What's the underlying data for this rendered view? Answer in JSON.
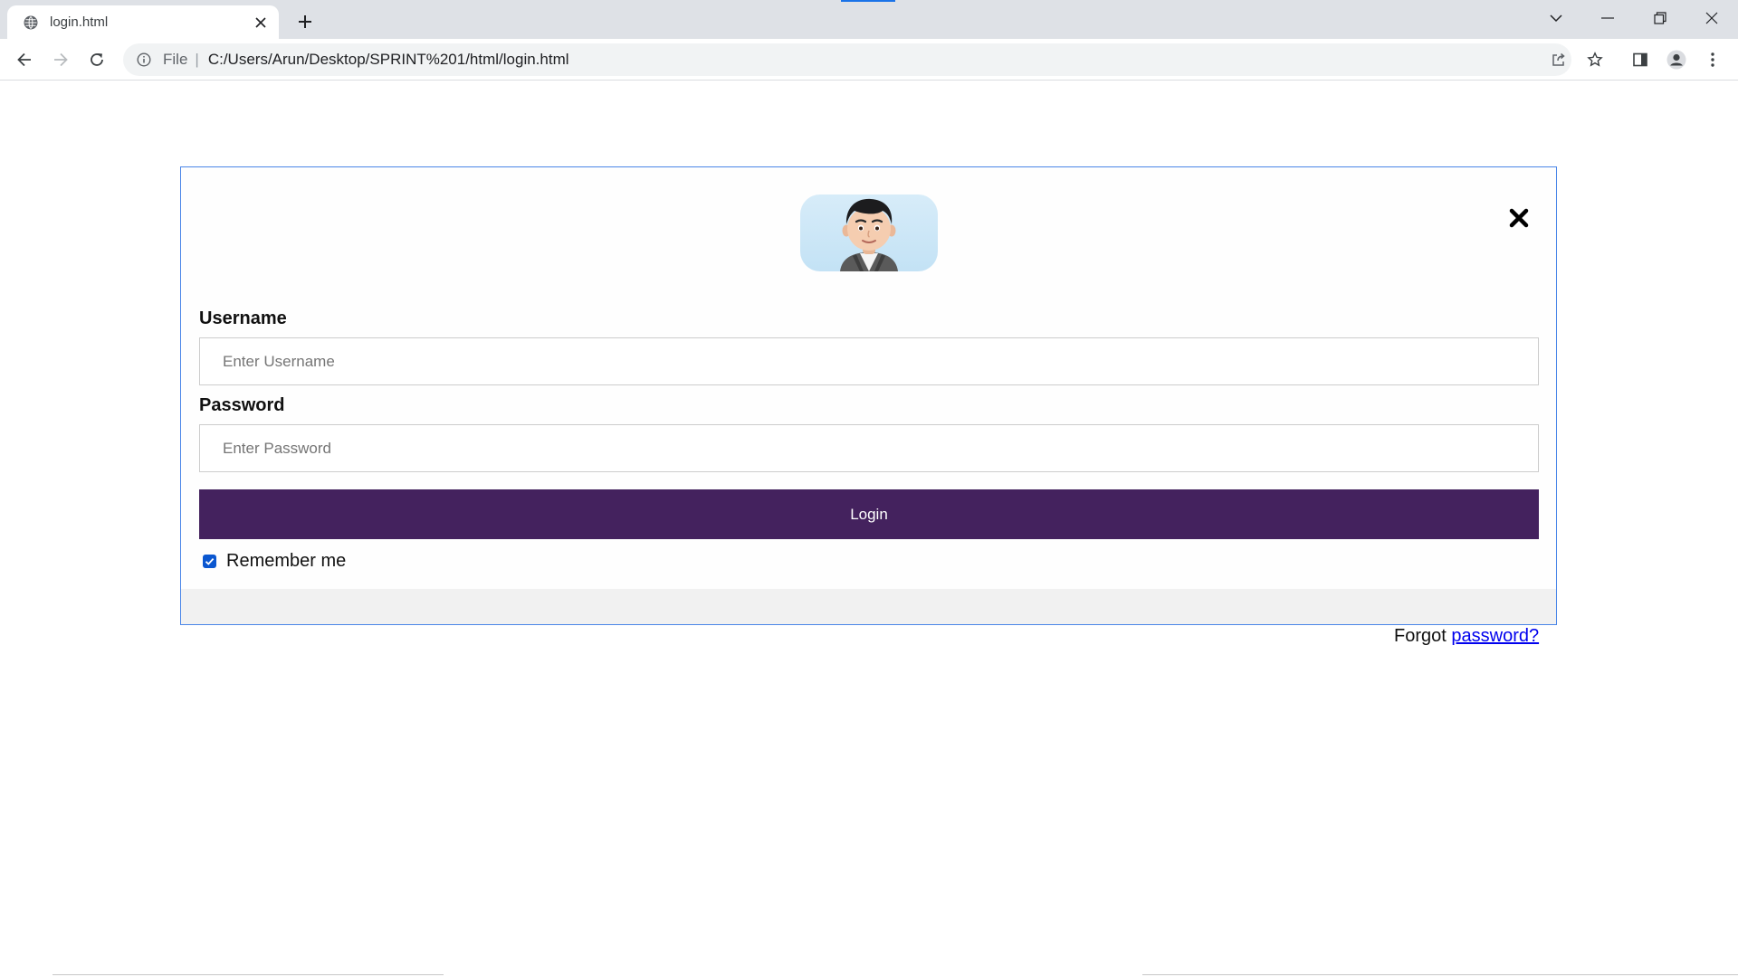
{
  "browser": {
    "tab_title": "login.html",
    "tab_icon": "globe-icon",
    "address_scheme": "File",
    "address_separator": "|",
    "address_url": "C:/Users/Arun/Desktop/SPRINT%201/html/login.html"
  },
  "login": {
    "avatar_icon": "user-avatar",
    "close_symbol": "×",
    "username_label": "Username",
    "username_placeholder": "Enter Username",
    "username_value": "",
    "password_label": "Password",
    "password_placeholder": "Enter Password",
    "password_value": "",
    "login_button": "Login",
    "remember_label": "Remember me",
    "remember_checked": true,
    "forgot_prefix": "Forgot",
    "forgot_link": "password?"
  },
  "colors": {
    "accent_button": "#44225e",
    "modal_border": "#4a86e8",
    "link": "#0000ee",
    "checkbox": "#0b57d0"
  }
}
